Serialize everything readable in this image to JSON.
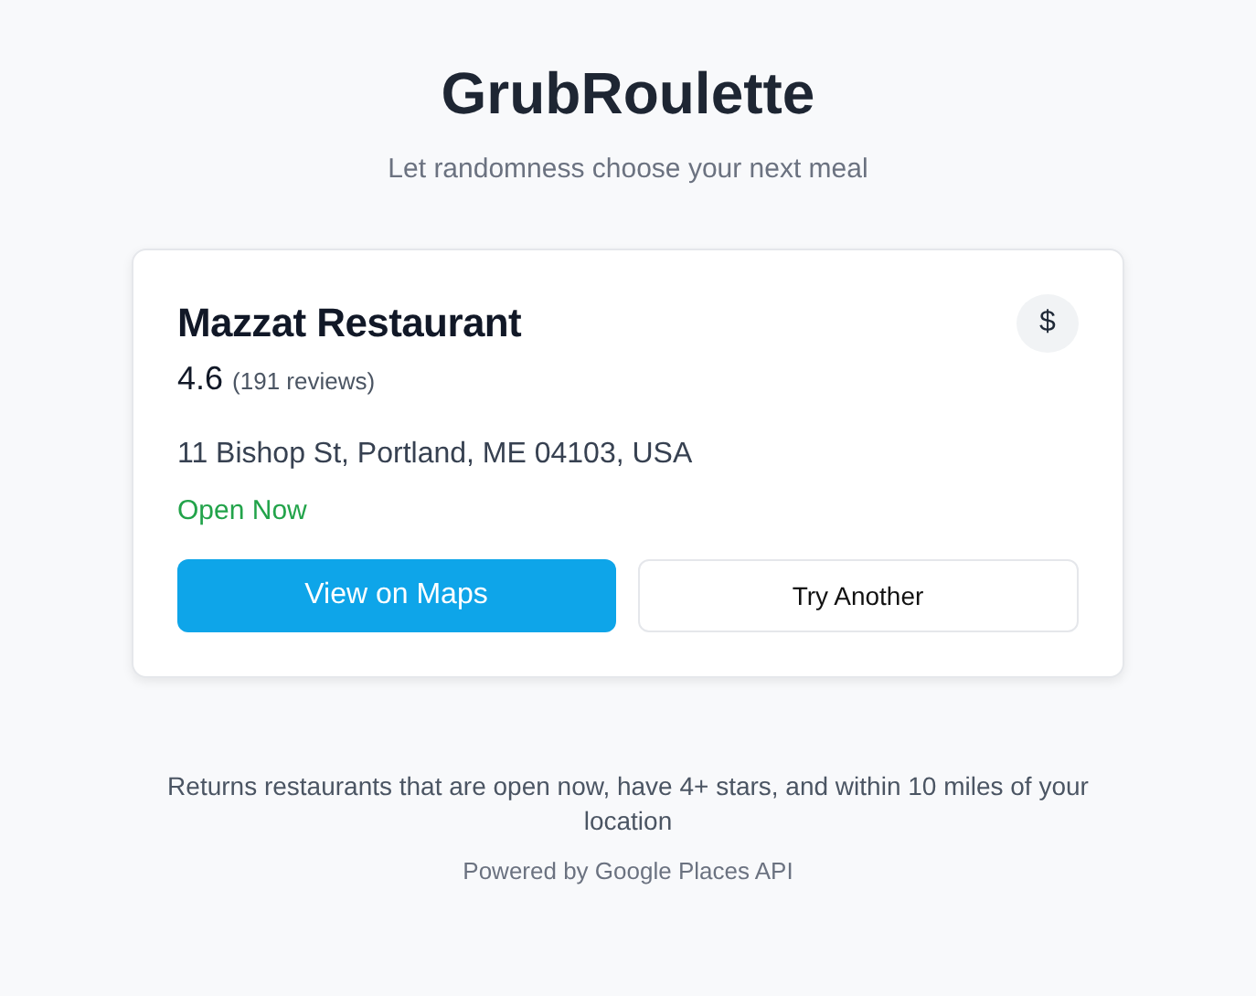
{
  "header": {
    "title": "GrubRoulette",
    "subtitle": "Let randomness choose your next meal"
  },
  "restaurant": {
    "name": "Mazzat Restaurant",
    "price": "$",
    "rating": "4.6",
    "reviews": "(191 reviews)",
    "address": "11 Bishop St, Portland, ME 04103, USA",
    "status": "Open Now",
    "open": true
  },
  "buttons": [
    {
      "label": "View on Maps",
      "kind": "primary"
    },
    {
      "label": "Try Another",
      "kind": "secondary"
    }
  ],
  "footer": {
    "note": "Returns restaurants that are open now, have 4+ stars, and within 10 miles of your location",
    "credit": "Powered by Google Places API"
  }
}
